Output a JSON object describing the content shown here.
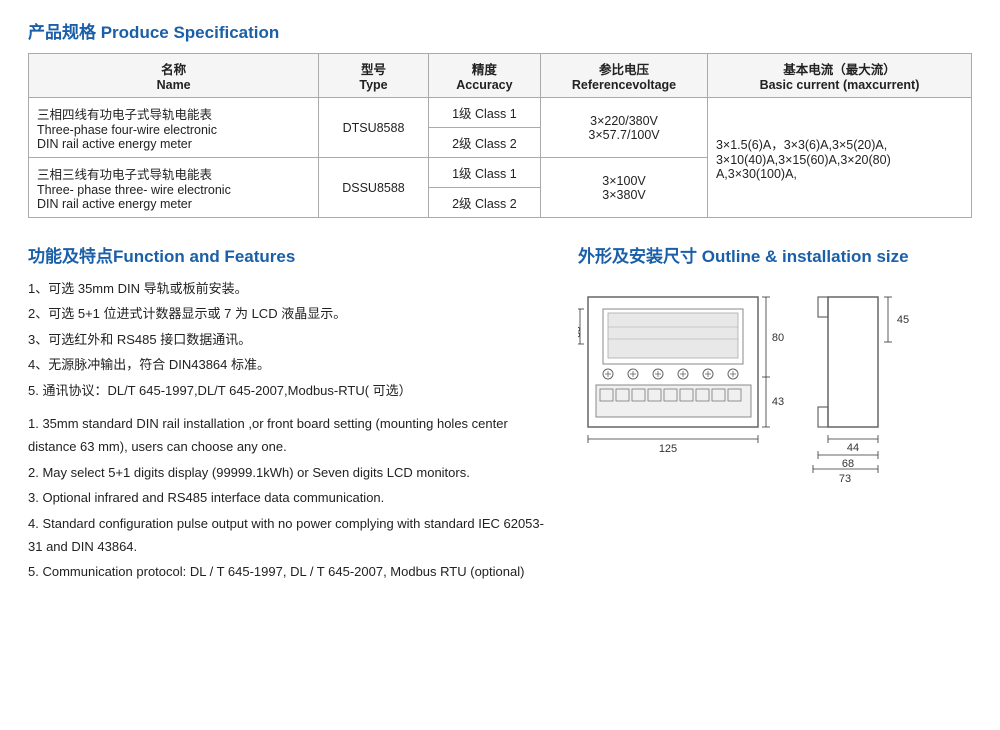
{
  "product_spec_title": "产品规格 Produce Specification",
  "table": {
    "headers": [
      "名称\nName",
      "型号\nType",
      "精度\nAccuracy",
      "参比电压\nReferencevoltage",
      "基本电流（最大流）\nBasic current (maxcurrent)"
    ],
    "rows": [
      {
        "name_cn": "三相四线有功电子式导轨电能表",
        "name_en": "Three-phase four-wire electronic DIN rail active energy meter",
        "type": "DTSU8588",
        "accuracy": [
          "1级 Class 1",
          "2级 Class 2"
        ],
        "voltage": "3×220/380V\n3×57.7/100V",
        "current": "3×1.5(6)A，3×3(6)A,3×5(20)A,\n3×10(40)A,3×15(60)A,3×20(80)\nA,3×30(100)A,"
      },
      {
        "name_cn": "三相三线有功电子式导轨电能表",
        "name_en": "Three- phase three- wire electronic DIN rail active energy meter",
        "type": "DSSU8588",
        "accuracy": [
          "1级 Class 1",
          "2级 Class 2"
        ],
        "voltage": "3×100V\n3×380V",
        "current": ""
      }
    ]
  },
  "features_title": "功能及特点Function and Features",
  "features_cn": [
    "1、可选 35mm DIN 导轨或板前安装。",
    "2、可选 5+1 位进式计数器显示或 7 为 LCD 液晶显示。",
    "3、可选红外和 RS485 接口数据通讯。",
    "4、无源脉冲输出，符合 DIN43864 标准。",
    "5. 通讯协议：DL/T 645-1997,DL/T 645-2007,Modbus-RTU( 可选）"
  ],
  "features_en": [
    "1. 35mm standard DIN rail installation ,or front board setting (mounting holes center distance 63 mm), users can choose any one.",
    "2. May select 5+1 digits display (99999.1kWh) or Seven digits LCD monitors.",
    "3. Optional infrared and RS485 interface data communication.",
    "4. Standard configuration pulse output with no power complying with standard IEC 62053-31 and DIN 43864.",
    "5. Communication protocol: DL / T 645-1997, DL / T 645-2007, Modbus RTU (optional)"
  ],
  "outline_title": "外形及安装尺寸 Outline & installation size"
}
